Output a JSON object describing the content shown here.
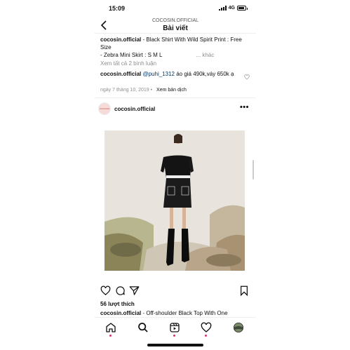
{
  "status_bar": {
    "time": "15:09",
    "network": "4G"
  },
  "header": {
    "account": "COCOSIN.OFFICIAL",
    "title": "Bài viết"
  },
  "caption": {
    "user": "cocosin.official",
    "text": " - Black Shirt With Wild Spirit Print : Free Size",
    "text2": "- Zebra Mini Skirt : S M L",
    "more": "... khác"
  },
  "comments_link": "Xem tất cả 2 bình luận",
  "comment": {
    "user": "cocosin.official",
    "mention": "@puhi_1312",
    "text": " áo giá 490k,váy 650k ạ"
  },
  "meta": {
    "date": "ngày 7 tháng 10, 2019",
    "separator": "•",
    "translate": "Xem bản dịch"
  },
  "post": {
    "avatar_text": "COCOSIN",
    "user": "cocosin.official",
    "likes": "56 lượt thích",
    "caption_user": "cocosin.official",
    "caption_text": " - Off-shoulder Black Top With One"
  },
  "colors": {
    "accent": "#e1306c",
    "link": "#00376b",
    "muted": "#8e8e8e"
  },
  "tabs": [
    "home-icon",
    "search-icon",
    "reels-icon",
    "activity-heart-icon",
    "profile-avatar"
  ]
}
